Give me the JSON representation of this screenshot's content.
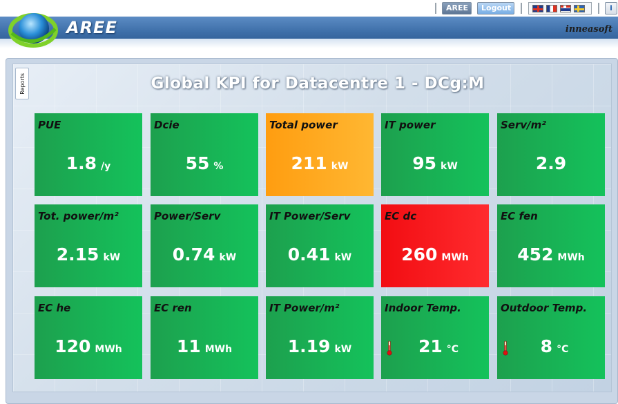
{
  "header": {
    "brand": "AREE",
    "vendor": "inneasoft",
    "buttons": {
      "aree": "AREE",
      "logout": "Logout",
      "info": "i"
    },
    "languages": [
      "en",
      "fr",
      "no",
      "se"
    ]
  },
  "sidebar": {
    "tab_label": "Reports"
  },
  "main": {
    "title": "Global KPI for Datacentre 1 - DCg:M"
  },
  "colors": {
    "green": "#1db356",
    "orange": "#ffa820",
    "red": "#f81518"
  },
  "tiles": [
    {
      "label": "PUE",
      "value": "1.8",
      "unit": "/y",
      "status": "green"
    },
    {
      "label": "Dcie",
      "value": "55",
      "unit": "%",
      "status": "green"
    },
    {
      "label": "Total power",
      "value": "211",
      "unit": "kW",
      "status": "orange"
    },
    {
      "label": "IT power",
      "value": "95",
      "unit": "kW",
      "status": "green"
    },
    {
      "label": "Serv/m²",
      "value": "2.9",
      "unit": "",
      "status": "green"
    },
    {
      "label": "Tot. power/m²",
      "value": "2.15",
      "unit": "kW",
      "status": "green"
    },
    {
      "label": "Power/Serv",
      "value": "0.74",
      "unit": "kW",
      "status": "green"
    },
    {
      "label": "IT Power/Serv",
      "value": "0.41",
      "unit": "kW",
      "status": "green"
    },
    {
      "label": "EC dc",
      "value": "260",
      "unit": "MWh",
      "status": "red"
    },
    {
      "label": "EC fen",
      "value": "452",
      "unit": "MWh",
      "status": "green"
    },
    {
      "label": "EC he",
      "value": "120",
      "unit": "MWh",
      "status": "green"
    },
    {
      "label": "EC ren",
      "value": "11",
      "unit": "MWh",
      "status": "green"
    },
    {
      "label": "IT Power/m²",
      "value": "1.19",
      "unit": "kW",
      "status": "green"
    },
    {
      "label": "Indoor Temp.",
      "value": "21",
      "unit": "°C",
      "status": "green",
      "icon": "thermometer-icon"
    },
    {
      "label": "Outdoor Temp.",
      "value": "8",
      "unit": "°C",
      "status": "green",
      "icon": "thermometer-icon"
    }
  ]
}
